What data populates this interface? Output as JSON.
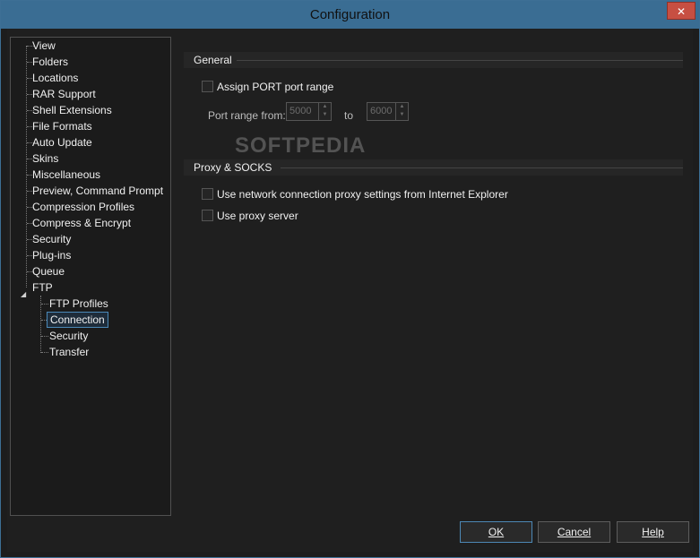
{
  "window": {
    "title": "Configuration",
    "close_glyph": "✕"
  },
  "tree": {
    "items": [
      {
        "label": "View"
      },
      {
        "label": "Folders"
      },
      {
        "label": "Locations"
      },
      {
        "label": "RAR Support"
      },
      {
        "label": "Shell Extensions"
      },
      {
        "label": "File Formats"
      },
      {
        "label": "Auto Update"
      },
      {
        "label": "Skins"
      },
      {
        "label": "Miscellaneous"
      },
      {
        "label": "Preview, Command Prompt"
      },
      {
        "label": "Compression Profiles"
      },
      {
        "label": "Compress & Encrypt"
      },
      {
        "label": "Security"
      },
      {
        "label": "Plug-ins"
      },
      {
        "label": "Queue"
      },
      {
        "label": "FTP"
      }
    ],
    "ftp_children": [
      {
        "label": "FTP Profiles"
      },
      {
        "label": "Connection",
        "selected": true
      },
      {
        "label": "Security"
      },
      {
        "label": "Transfer"
      }
    ],
    "expander_glyph": "◢"
  },
  "general": {
    "header": "General",
    "assign_port_label": "Assign PORT port range",
    "port_range_from_label": "Port range from:",
    "port_from_value": "5000",
    "to_label": "to",
    "port_to_value": "6000"
  },
  "proxy": {
    "header": "Proxy & SOCKS",
    "ie_proxy_label": "Use network connection proxy settings from Internet Explorer",
    "use_proxy_label": "Use proxy server"
  },
  "watermark": "SOFTPEDIA",
  "buttons": {
    "ok": "OK",
    "cancel": "Cancel",
    "help": "Help"
  },
  "colors": {
    "accent": "#3a6d93",
    "selection_border": "#4b89b8",
    "close": "#c74f42"
  }
}
